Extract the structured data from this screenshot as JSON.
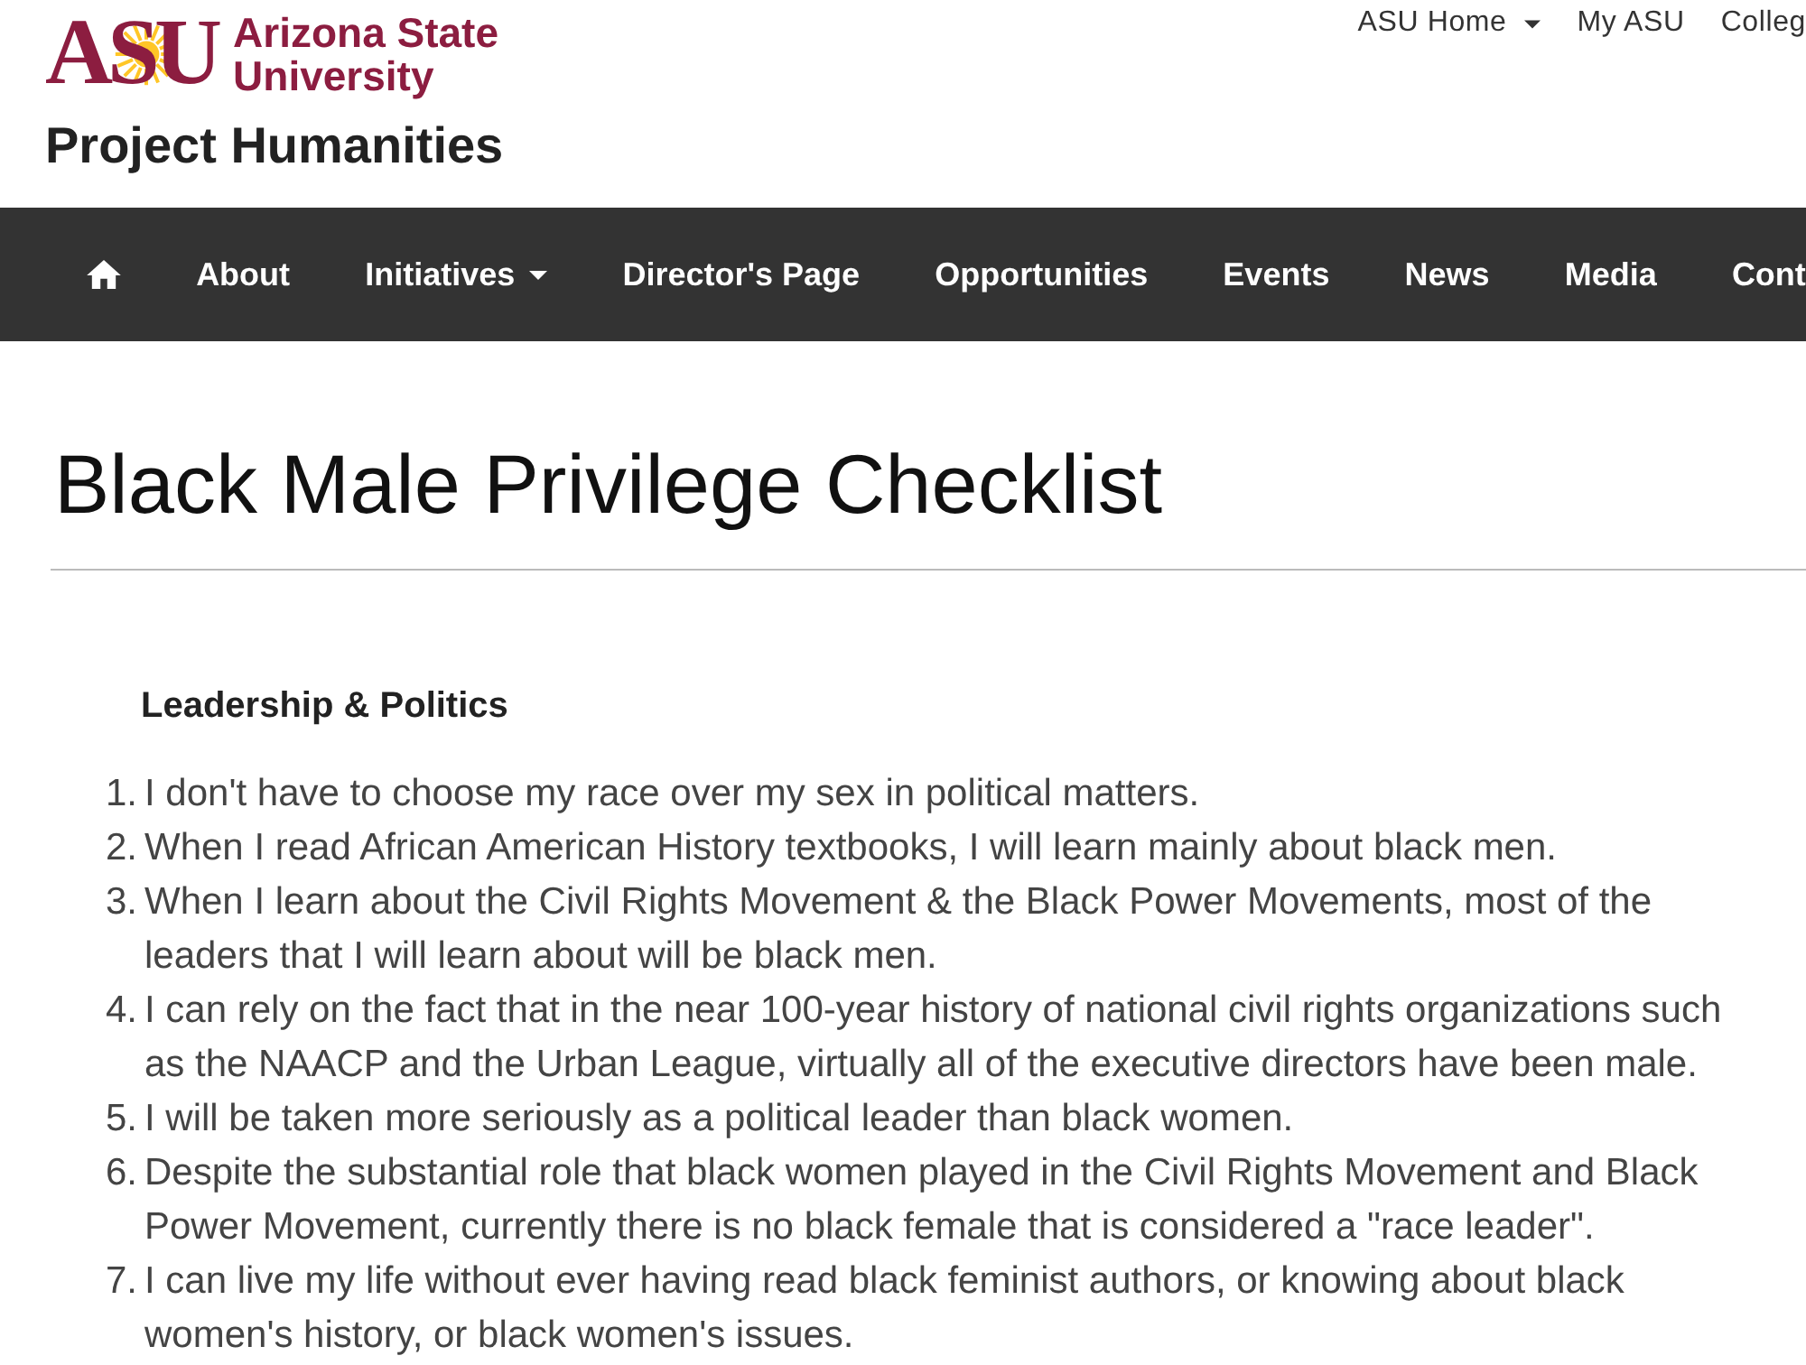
{
  "header": {
    "logo": {
      "mark": "ASU",
      "name_lines": [
        "Arizona State",
        "University"
      ]
    },
    "site_title": "Project Humanities",
    "top_links": [
      {
        "kind": "dropdown",
        "label": "ASU Home"
      },
      {
        "kind": "link",
        "label": "My ASU"
      },
      {
        "kind": "link",
        "label": "Colleg"
      }
    ]
  },
  "nav": {
    "items": [
      {
        "kind": "home"
      },
      {
        "kind": "link",
        "label": "About"
      },
      {
        "kind": "dropdown",
        "label": "Initiatives"
      },
      {
        "kind": "link",
        "label": "Director's Page"
      },
      {
        "kind": "link",
        "label": "Opportunities"
      },
      {
        "kind": "link",
        "label": "Events"
      },
      {
        "kind": "link",
        "label": "News"
      },
      {
        "kind": "link",
        "label": "Media"
      },
      {
        "kind": "link",
        "label": "Cont"
      }
    ]
  },
  "page": {
    "title": "Black Male Privilege Checklist",
    "section_heading": "Leadership & Politics",
    "items": [
      {
        "number": "1.",
        "text": "I don't have to choose my race over my sex in political matters."
      },
      {
        "number": "2.",
        "text": "When I read African American History textbooks, I will learn mainly about black men."
      },
      {
        "number": "3.",
        "text": "When I learn about the Civil Rights Movement & the Black Power Movements, most of the leaders that I will learn about will be black men."
      },
      {
        "number": "4.",
        "text": "I can rely on the fact that in the near 100-year history of national civil rights organizations such as the NAACP and the Urban League, virtually all of the executive directors have been male."
      },
      {
        "number": "5.",
        "text": "I will be taken more seriously as a political leader than black women."
      },
      {
        "number": "6.",
        "text": "Despite the substantial role that black women played in the Civil Rights Movement and Black Power Movement, currently there is no black female that is considered a \"race leader\"."
      },
      {
        "number": "7.",
        "text": "I can live my life without ever having read black feminist authors, or knowing about black women's history, or black women's issues."
      }
    ]
  }
}
